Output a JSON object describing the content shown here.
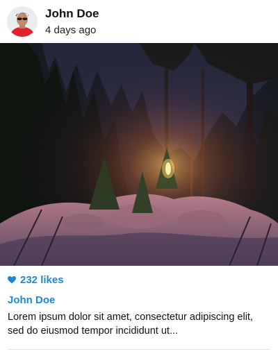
{
  "post": {
    "author_name": "John Doe",
    "timestamp": "4 days ago",
    "image_alt": "Snowy forest at night with a glowing lantern",
    "likes_label": "232 likes",
    "caption_author": "John Doe",
    "caption_text": "Lorem ipsum dolor sit amet, consectetur adipiscing elit, sed do eiusmod tempor incididunt ut..."
  },
  "colors": {
    "accent": "#1e88d6",
    "text": "#111111",
    "divider": "#e3e3e3"
  },
  "icons": {
    "like": "heart-icon"
  }
}
